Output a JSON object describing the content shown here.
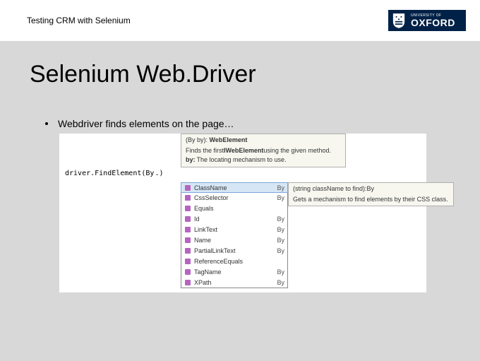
{
  "header": {
    "topbar_title": "Testing CRM with Selenium",
    "logo_uni": "UNIVERSITY OF",
    "logo_name": "OXFORD"
  },
  "slide": {
    "title": "Selenium Web.Driver",
    "bullet": "Webdriver finds elements on the page…"
  },
  "hint": {
    "signature_pre": "(By by): ",
    "signature_type": "WebElement",
    "desc_pre": "Finds the first ",
    "desc_bold": "IWebElement",
    "desc_post": " using the given method.",
    "by_label": "by:",
    "by_text": " The locating mechanism to use."
  },
  "editor": {
    "expr_a": "driver",
    "expr_b": ".FindElement",
    "expr_c": "(By",
    "caret": ".)"
  },
  "ac": {
    "items": [
      {
        "label": "ClassName",
        "ret": "By"
      },
      {
        "label": "CssSelector",
        "ret": "By"
      },
      {
        "label": "Equals",
        "ret": ""
      },
      {
        "label": "Id",
        "ret": "By"
      },
      {
        "label": "LinkText",
        "ret": "By"
      },
      {
        "label": "Name",
        "ret": "By"
      },
      {
        "label": "PartialLinkText",
        "ret": "By"
      },
      {
        "label": "ReferenceEquals",
        "ret": ""
      },
      {
        "label": "TagName",
        "ret": "By"
      },
      {
        "label": "XPath",
        "ret": "By"
      }
    ],
    "tooltip_sig": "(string className to find):By",
    "tooltip_desc": "Gets a mechanism to find elements by their CSS class."
  }
}
